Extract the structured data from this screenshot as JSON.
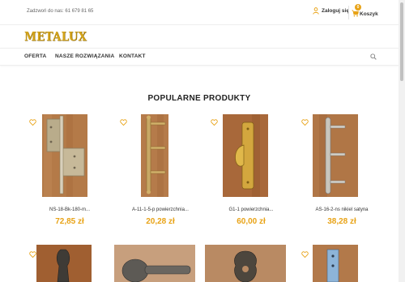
{
  "topbar": {
    "phone": "Zadzwoń do nas: 61 679 81 65",
    "login_label": "Zaloguj się",
    "cart_count": "0",
    "cart_label": "Koszyk"
  },
  "brand": {
    "logo_text": "METALUX",
    "accent": "#e8a317"
  },
  "nav": {
    "items": [
      "OFERTA",
      "NASZE ROZWIĄZANIA",
      "KONTAKT"
    ]
  },
  "section": {
    "title": "POPULARNE PRODUKTY"
  },
  "products": [
    {
      "name": "NS-18-Bk-180-m...",
      "price": "72,85 zł"
    },
    {
      "name": "A-11-1-5-p powierzchnia...",
      "price": "20,28 zł"
    },
    {
      "name": "G1-1 powierzchnia...",
      "price": "60,00 zł"
    },
    {
      "name": "AS-16-2-ns nikiel satyna",
      "price": "38,28 zł"
    }
  ]
}
